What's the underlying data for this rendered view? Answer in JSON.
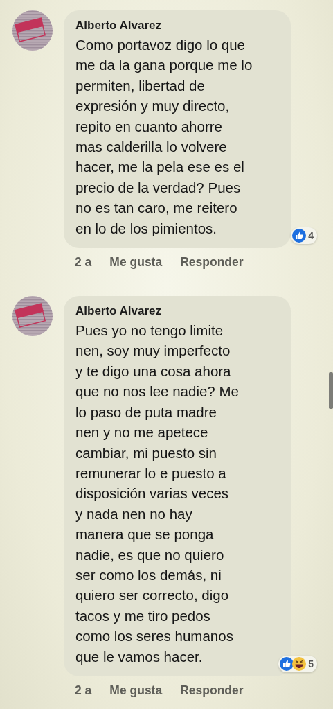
{
  "comments": [
    {
      "author": "Alberto Alvarez",
      "text": "Como portavoz digo lo que\nme da la gana porque me lo\npermiten, libertad de\nexpresión y muy directo,\nrepito en cuanto ahorre\nmas calderilla lo volvere\nhacer, me la pela ese es el\nprecio de la verdad? Pues\nno es tan caro, me reitero\nen lo de los pimientos.",
      "reactions": [
        {
          "kind": "like"
        }
      ],
      "reaction_count": "4",
      "time": "2 a",
      "actions": [
        "Me gusta",
        "Responder"
      ]
    },
    {
      "author": "Alberto Alvarez",
      "text": "Pues yo no tengo limite\nnen, soy muy imperfecto\ny te digo una cosa ahora\nque no nos lee nadie? Me\nlo paso de puta madre\nnen y no me apetece\ncambiar, mi puesto sin\nremunerar lo e puesto a\ndisposición varias veces\ny nada nen no hay\nmanera que se ponga\nnadie, es que no quiero\nser como los demás, ni\nquiero ser correcto, digo\ntacos y me tiro pedos\ncomo los seres humanos\nque le vamos hacer.",
      "reactions": [
        {
          "kind": "like"
        },
        {
          "kind": "haha"
        }
      ],
      "reaction_count": "5",
      "time": "2 a",
      "actions": [
        "Me gusta",
        "Responder"
      ]
    }
  ]
}
